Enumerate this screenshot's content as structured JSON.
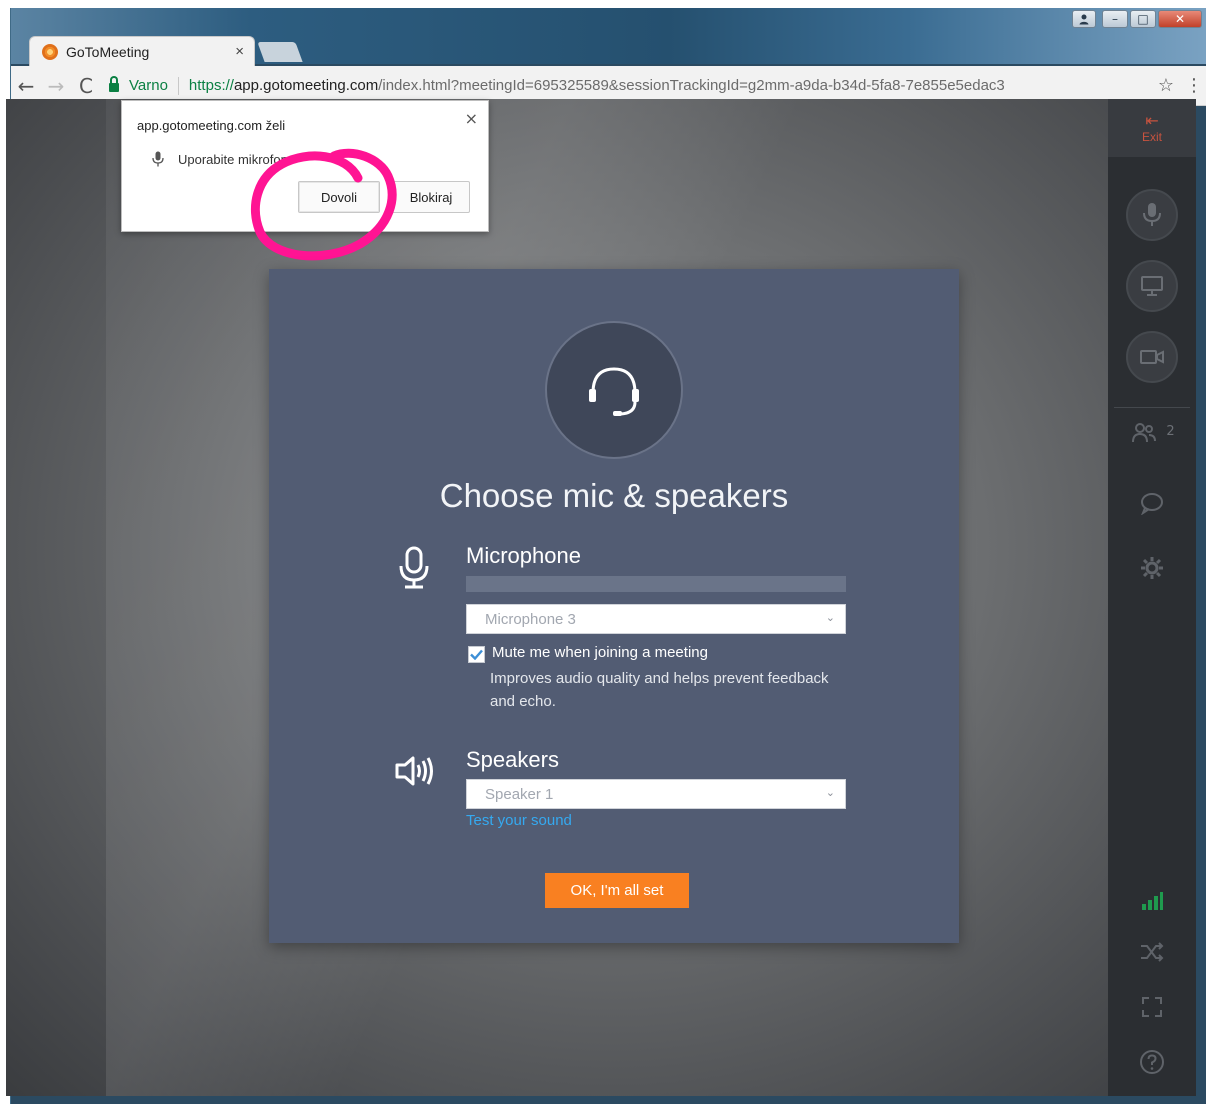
{
  "browser": {
    "tab": {
      "title": "GoToMeeting",
      "favicon": "gotomeeting-favicon",
      "close": "×"
    },
    "window_controls": {
      "user": "user-icon",
      "minimize": "–",
      "maximize": "□",
      "close": "✕"
    },
    "nav": {
      "back": "←",
      "forward": "→",
      "reload": "C"
    },
    "address": {
      "secure_label": "Varno",
      "scheme": "https://",
      "host": "app.gotomeeting.com",
      "path": "/index.html?meetingId=695325589&sessionTrackingId=g2mm-a9da-b34d-5fa8-7e855e5edac3"
    },
    "bookmark_icon": "☆",
    "menu_icon": "⋮"
  },
  "permission_popup": {
    "title": "app.gotomeeting.com želi",
    "request": "Uporabite mikrofon",
    "allow_label": "Dovoli",
    "block_label": "Blokiraj",
    "close": "×",
    "highlight_color": "#ff1493"
  },
  "dialog": {
    "title": "Choose mic & speakers",
    "microphone": {
      "heading": "Microphone",
      "selected_device": "Microphone 3",
      "mute_checked": true,
      "mute_label": "Mute me when joining a meeting",
      "mute_help": "Improves audio quality and helps prevent feedback and echo."
    },
    "speakers": {
      "heading": "Speakers",
      "selected_device": "Speaker 1",
      "test_link": "Test your sound"
    },
    "ok_button": "OK, I'm all set",
    "colors": {
      "panel": "#525c73",
      "accent": "#f98021",
      "link": "#35a9f0"
    }
  },
  "sidebar": {
    "exit_label": "Exit",
    "attendee_count": "2",
    "icons": [
      "mic-icon",
      "screen-share-icon",
      "webcam-icon",
      "attendees-icon",
      "chat-icon",
      "settings-icon",
      "signal-icon",
      "shuffle-icon",
      "fullscreen-icon",
      "help-icon"
    ]
  }
}
